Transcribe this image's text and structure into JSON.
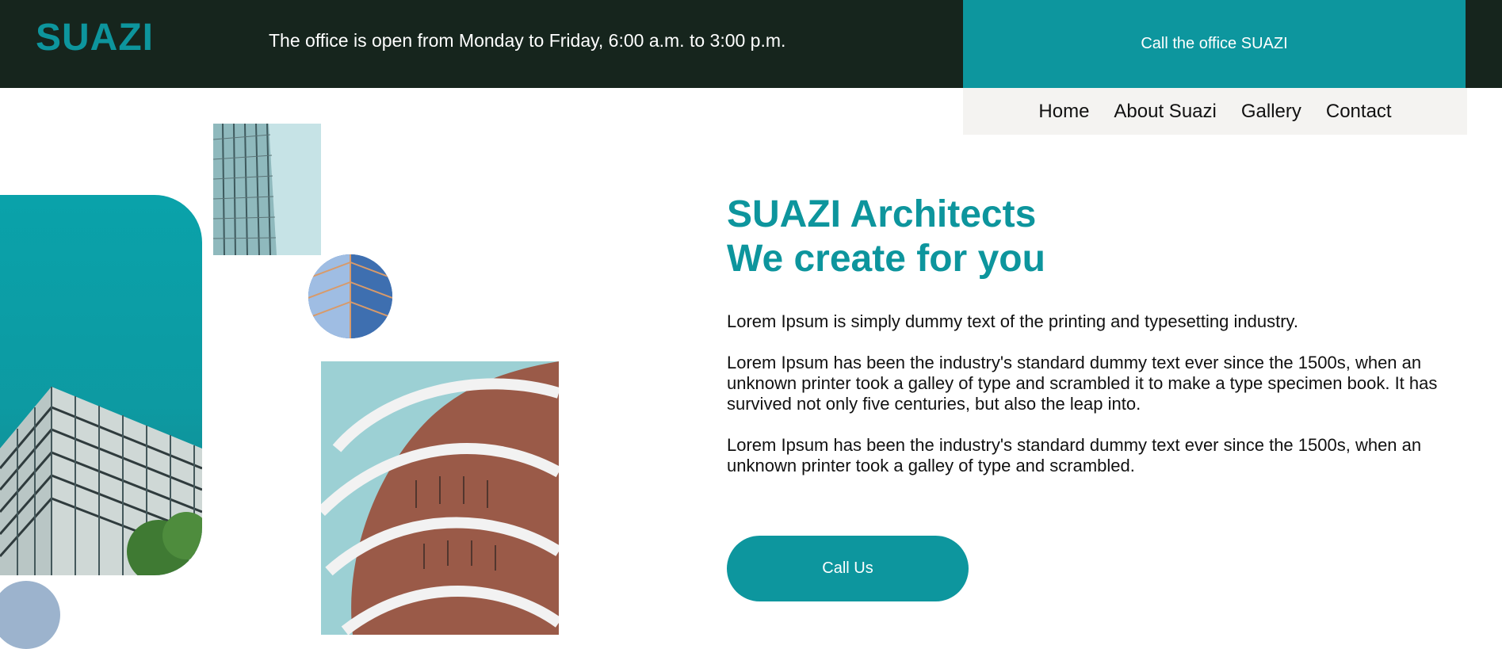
{
  "header": {
    "logo": "SUAZI",
    "hours": "The office is open from Monday to Friday, 6:00 a.m. to 3:00 p.m.",
    "call_office_label": "Call the office SUAZI"
  },
  "nav": {
    "items": [
      {
        "label": "Home"
      },
      {
        "label": "About Suazi"
      },
      {
        "label": "Gallery"
      },
      {
        "label": "Contact"
      }
    ]
  },
  "hero": {
    "title_line1": "SUAZI Architects",
    "title_line2": "We create for you",
    "paragraphs": [
      "Lorem Ipsum is simply dummy text of the printing and typesetting industry.",
      "Lorem Ipsum has been the industry's standard dummy text ever since the 1500s, when an unknown printer took a galley of type and scrambled it to make a type specimen book. It has survived not only five centuries, but also the leap into.",
      "Lorem Ipsum has been the industry's standard dummy text ever since the 1500s, when an unknown printer took a galley of type and scrambled."
    ],
    "cta_label": "Call Us"
  },
  "colors": {
    "brand_teal": "#0d969e",
    "topbar_dark": "#16251d",
    "nav_bg": "#f4f3f1",
    "accent_blob": "#9cb3cd"
  },
  "images": [
    {
      "name": "glass-building-photo"
    },
    {
      "name": "skyscraper-photo"
    },
    {
      "name": "glass-tower-round-photo"
    },
    {
      "name": "curved-balcony-building-photo"
    }
  ]
}
